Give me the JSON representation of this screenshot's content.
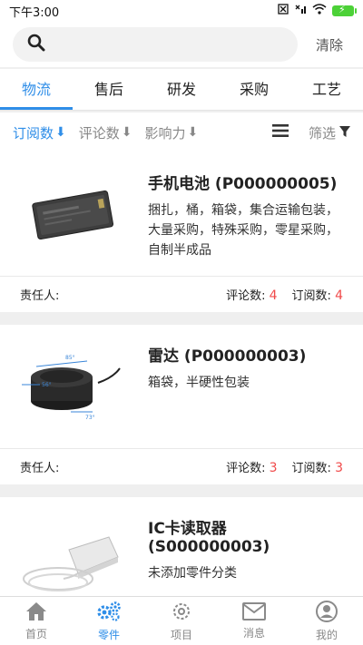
{
  "status": {
    "time": "下午3:00",
    "battery_icon": "battery-charging-icon"
  },
  "search": {
    "clear_label": "清除"
  },
  "tabs": [
    {
      "label": "物流"
    },
    {
      "label": "售后"
    },
    {
      "label": "研发"
    },
    {
      "label": "采购"
    },
    {
      "label": "工艺"
    }
  ],
  "sort": {
    "subscriptions": "订阅数",
    "comments": "评论数",
    "influence": "影响力",
    "filter": "筛选"
  },
  "items": [
    {
      "title": "手机电池 (P000000005)",
      "desc": "捆扎，桶，箱袋，集合运输包装，大量采购，特殊采购，零星采购，自制半成品",
      "owner_label": "责任人:",
      "comment_label": "评论数:",
      "comment_count": "4",
      "subscribe_label": "订阅数:",
      "subscribe_count": "4"
    },
    {
      "title": "雷达 (P000000003)",
      "desc": "箱袋，半硬性包装",
      "owner_label": "责任人:",
      "comment_label": "评论数:",
      "comment_count": "3",
      "subscribe_label": "订阅数:",
      "subscribe_count": "3"
    },
    {
      "title": "IC卡读取器 (S000000003)",
      "desc": "未添加零件分类"
    }
  ],
  "radar_image": {
    "labels": [
      "85°",
      "56°",
      "73°"
    ]
  },
  "bottom_nav": [
    {
      "label": "首页"
    },
    {
      "label": "零件"
    },
    {
      "label": "项目"
    },
    {
      "label": "消息"
    },
    {
      "label": "我的"
    }
  ],
  "colors": {
    "accent": "#2f8ee8",
    "count": "#f04a4a"
  }
}
